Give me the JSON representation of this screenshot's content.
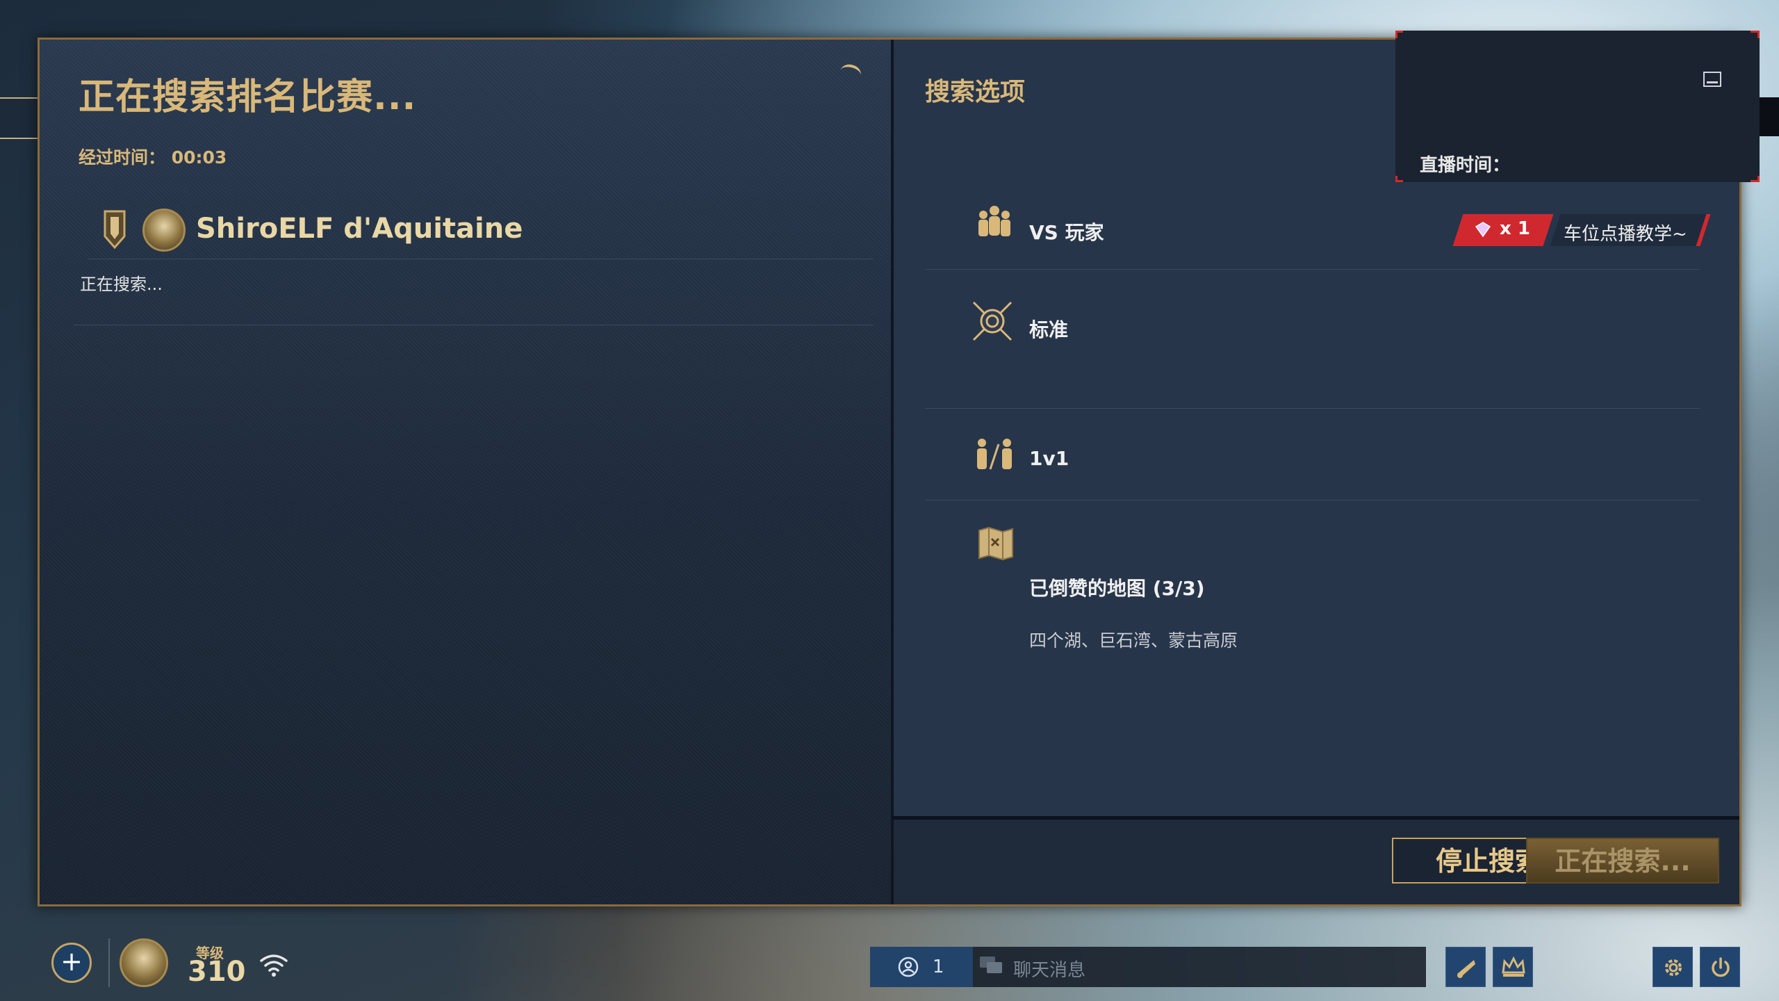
{
  "search_panel": {
    "title": "正在搜索排名比赛...",
    "elapsed_label": "经过时间：",
    "elapsed_value": "00:03",
    "player_name": "ShiroELF d'Aquitaine",
    "status_text": "正在搜索..."
  },
  "options_panel": {
    "title": "搜索选项",
    "options": [
      {
        "icon": "players-group-icon",
        "label": "VS 玩家"
      },
      {
        "icon": "crossed-swords-shield-icon",
        "label": "标准"
      },
      {
        "icon": "one-vs-one-icon",
        "label": "1v1"
      },
      {
        "icon": "map-icon",
        "label": "已倒赞的地图 (3/3)",
        "sub": "四个湖、巨石湾、蒙古高原"
      }
    ]
  },
  "stream_overlay": {
    "label": "直播时间：",
    "banner_count": "x 1",
    "banner_text": "车位点播教学~"
  },
  "buttons": {
    "stop": "停止搜索",
    "searching": "正在搜索..."
  },
  "bottom_bar": {
    "add_label": "+",
    "level_label": "等级",
    "level_value": "310",
    "friends_count": "1",
    "chat_placeholder": "聊天消息"
  },
  "colors": {
    "accent_gold": "#d9b87a",
    "panel_dark": "#27354a",
    "banner_red": "#d0282f"
  }
}
